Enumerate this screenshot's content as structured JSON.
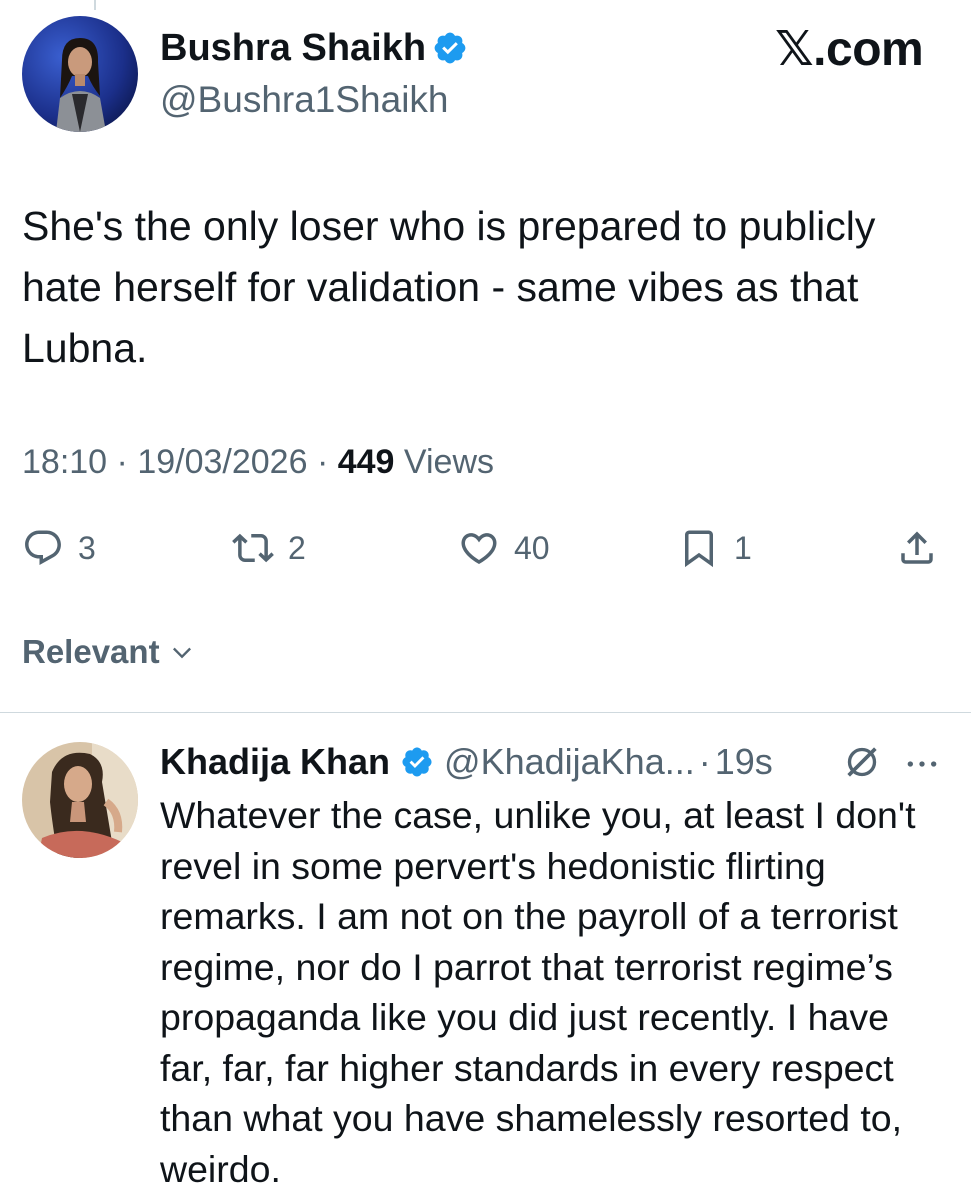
{
  "brand": {
    "label": "𝕏.com"
  },
  "colors": {
    "verified": "#1d9bf0",
    "muted": "#536471",
    "text": "#0f1419",
    "divider": "#cfd9de"
  },
  "tweet": {
    "author_name": "Bushra Shaikh",
    "author_handle": "@Bushra1Shaikh",
    "text": "She's the only loser who is prepared to publicly hate herself for validation - same vibes as that Lubna.",
    "time": "18:10",
    "date": "19/03/2026",
    "views_count": "449",
    "views_label": "Views",
    "separator": "·",
    "actions": {
      "replies": "3",
      "reposts": "2",
      "likes": "40",
      "bookmarks": "1"
    }
  },
  "sort": {
    "label": "Relevant"
  },
  "reply": {
    "author_name": "Khadija Khan",
    "author_handle": "@KhadijaKha...",
    "separator": "·",
    "time": "19s",
    "text": "Whatever the case, unlike you, at least I don't revel in some pervert's hedonistic flirting remarks. I am not on the payroll of a terrorist regime, nor do I parrot that terrorist regime’s propaganda like you did just recently. I have far, far, far higher standards in every respect than what you have shamelessly resorted to, weirdo."
  },
  "icons": {
    "verified": "verified-badge-icon",
    "reply": "reply-icon",
    "repost": "repost-icon",
    "like": "heart-icon",
    "bookmark": "bookmark-icon",
    "share": "share-icon",
    "sort": "chevron-down-icon",
    "grok": "grok-icon",
    "more": "more-icon"
  }
}
